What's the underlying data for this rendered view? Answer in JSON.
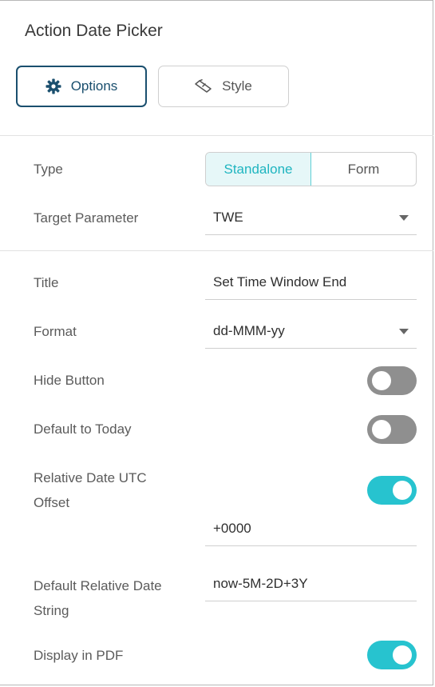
{
  "panel": {
    "title": "Action Date Picker"
  },
  "tabs": [
    {
      "label": "Options",
      "icon": "gear-icon",
      "active": true
    },
    {
      "label": "Style",
      "icon": "paintbrush-icon",
      "active": false
    }
  ],
  "type": {
    "label": "Type",
    "options": [
      "Standalone",
      "Form"
    ],
    "selected": "Standalone"
  },
  "target_parameter": {
    "label": "Target Parameter",
    "value": "TWE"
  },
  "title_field": {
    "label": "Title",
    "value": "Set Time Window End"
  },
  "format": {
    "label": "Format",
    "value": "dd-MMM-yy"
  },
  "hide_button": {
    "label": "Hide Button",
    "on": false
  },
  "default_today": {
    "label": "Default to Today",
    "on": false
  },
  "utc_offset": {
    "label_line1": "Relative Date UTC",
    "label_line2": "Offset",
    "on": true,
    "value": "+0000"
  },
  "relative_string": {
    "label_line1": "Default Relative Date",
    "label_line2": "String",
    "value": "now-5M-2D+3Y"
  },
  "display_pdf": {
    "label": "Display in PDF",
    "on": true
  },
  "colors": {
    "accent": "#27c3cf",
    "primary": "#1a4f6e",
    "toggle_off": "#8f8f8f"
  }
}
